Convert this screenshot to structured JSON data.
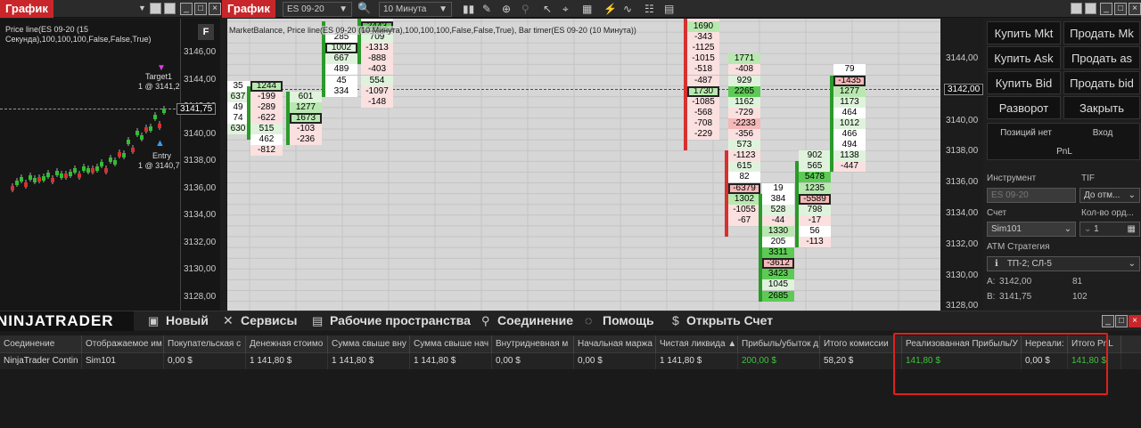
{
  "left_window": {
    "title": "График",
    "indicator_label": "Price line(ES 09-20 (15 Секунда),100,100,100,False,False,True)",
    "f_label": "F",
    "target_label": "Target1",
    "target_value": "1 @ 3141,2",
    "entry_label": "Entry",
    "entry_value": "1 @ 3140,7",
    "current_price": "3141,75",
    "axis": [
      "3146,00",
      "3144,00",
      "3142,00",
      "3140,00",
      "3138,00",
      "3136,00",
      "3134,00",
      "3132,00",
      "3130,00",
      "3128,00"
    ]
  },
  "main_window": {
    "title": "График",
    "instrument": "ES 09-20",
    "interval": "10 Минута",
    "indicator_label": "MarketBalance, Price line(ES 09-20 (10 Минута),100,100,100,False,False,True), Bar timer(ES 09-20 (10 Минута))",
    "f_label": "F",
    "current_price": "3142,00",
    "axis": [
      "3144,00",
      "3142,00",
      "3140,00",
      "3138,00",
      "3136,00",
      "3134,00",
      "3132,00",
      "3130,00",
      "3128,00"
    ]
  },
  "footprint": {
    "col1": [
      "35",
      "637",
      "49",
      "74",
      "630"
    ],
    "col2": [
      "1244",
      "-199",
      "-289",
      "-622",
      "515",
      "462",
      "-812"
    ],
    "col3": [
      "601",
      "1277",
      "1673",
      "-103",
      "-236"
    ],
    "col4": [
      "285",
      "1002",
      "667",
      "489",
      "45",
      "334"
    ],
    "col5": [
      "2443",
      "709",
      "-1313",
      "-888",
      "-403",
      "554",
      "-1097",
      "-148"
    ],
    "col5_top": "-97",
    "col6": [
      "-700",
      "1690",
      "-343",
      "-1125",
      "-1015",
      "-518",
      "-487",
      "1730",
      "-1085",
      "-568",
      "-708",
      "-229"
    ],
    "col7": [
      "1771",
      "-408",
      "929",
      "2265",
      "1162",
      "-729",
      "-2233",
      "-356",
      "573",
      "-1123",
      "615",
      "82",
      "-6379",
      "1302",
      "-1055",
      "-67"
    ],
    "col8": [
      "19",
      "384",
      "528",
      "-44",
      "1330",
      "205",
      "3311",
      "-3612",
      "3423",
      "1045",
      "2685"
    ],
    "col9": [
      "902",
      "565",
      "5478",
      "1235",
      "-5589",
      "798",
      "-17",
      "56",
      "-113"
    ],
    "col10": [
      "79",
      "-1435",
      "1277",
      "1173",
      "464",
      "1012",
      "466",
      "494",
      "1138",
      "-447"
    ]
  },
  "trade_panel": {
    "buy_mkt": "Купить Mkt",
    "sell_mkt": "Продать Mk",
    "buy_ask": "Купить Ask",
    "sell_as": "Продать as",
    "buy_bid": "Купить Bid",
    "sell_bid": "Продать bid",
    "reverse": "Разворот",
    "close": "Закрыть",
    "position": "Позиций нет",
    "entry": "Вход",
    "pnl": "PnL",
    "instrument_label": "Инструмент",
    "tif_label": "TIF",
    "instrument_value": "ES 09-20",
    "tif_value": "До отм...",
    "account_label": "Счет",
    "qty_label": "Кол-во орд...",
    "account_value": "Sim101",
    "qty_value": "1",
    "atm_label": "ATM Стратегия",
    "atm_value": "ТП-2; СЛ-5",
    "ask_label": "A:",
    "ask_price": "3142,00",
    "ask_size": "81",
    "bid_label": "B:",
    "bid_price": "3141,75",
    "bid_size": "102"
  },
  "menu": {
    "logo": "NINJATRADER",
    "items": [
      "Новый",
      "Сервисы",
      "Рабочие пространства",
      "Соединение",
      "Помощь",
      "Открыть Счет"
    ]
  },
  "accounts_grid": {
    "headers": [
      "Соединение",
      "Отображаемое им",
      "Покупательская с",
      "Денежная стоимо",
      "Сумма свыше вну",
      "Сумма свыше нач",
      "Внутридневная м",
      "Начальная маржа",
      "Чистая ликвида ▲",
      "Прибыль/убыток д",
      "Итого комиссии",
      "Реализованная Прибыль/У",
      "Нереали:",
      "Итого PnL"
    ],
    "row": [
      "NinjaTrader Contin",
      "Sim101",
      "0,00 $",
      "1 141,80 $",
      "1 141,80 $",
      "1 141,80 $",
      "0,00 $",
      "0,00 $",
      "1 141,80 $",
      "200,00 $",
      "58,20 $",
      "141,80 $",
      "0,00 $",
      "141,80 $"
    ]
  },
  "colors": {
    "accent_red": "#c8262a",
    "profit_green": "#3ec43e",
    "highlight_box": "#e0201c"
  }
}
